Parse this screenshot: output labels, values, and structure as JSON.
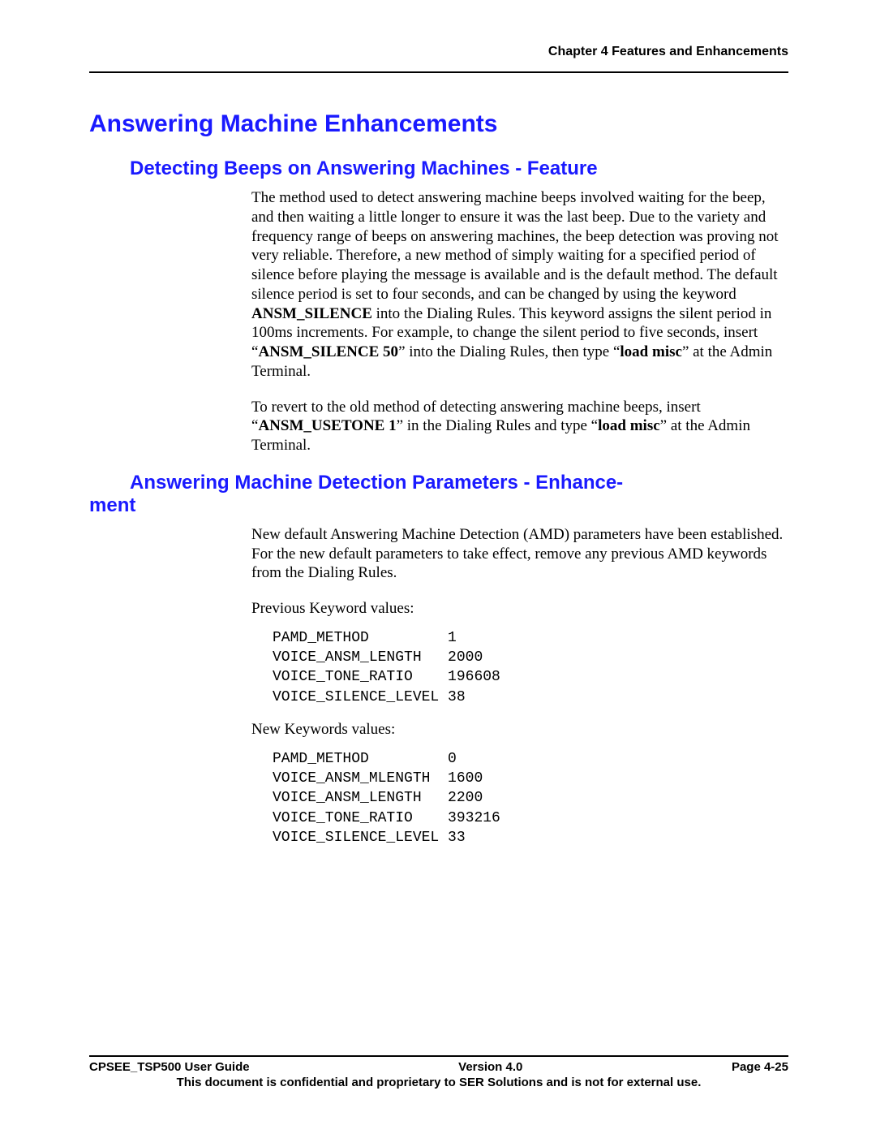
{
  "header": {
    "chapter": "Chapter 4 Features and Enhancements"
  },
  "h1": "Answering Machine Enhancements",
  "section1": {
    "heading": "Detecting Beeps on Answering Machines - Feature",
    "para1_a": "The method used to detect answering machine beeps involved waiting for the beep, and then waiting a little longer to ensure it was the last beep.  Due to the variety and frequency range of beeps on answering machines, the beep detection was proving not very reliable.   Therefore, a new method of simply waiting for a specified period of silence before playing the message is available and is the default method.  The default silence period is set to four seconds, and can be changed by using the keyword ",
    "kw1": "ANSM_SILENCE",
    "para1_b": " into the Dialing Rules.  This keyword assigns the silent period in 100ms increments.  For example, to change the silent period to five seconds, insert ",
    "para1_c_prefix": "“",
    "kw2": "ANSM_SILENCE 50",
    "para1_d": "” into the Dialing Rules, then type “",
    "kw3": "load misc",
    "para1_e": "” at the Admin Terminal.",
    "para2_a": "To revert to the old method of detecting answering machine beeps, insert “",
    "kw4": "ANSM_USETONE 1",
    "para2_b": "” in the Dialing Rules and type “",
    "kw5": "load misc",
    "para2_c": "” at the Admin Terminal."
  },
  "section2": {
    "heading_line1": "Answering Machine Detection Parameters - Enhance-",
    "heading_line2": "ment",
    "para1": "New default Answering Machine Detection (AMD) parameters have been established.  For the new default parameters to take effect, remove any previous AMD keywords from the Dialing Rules.",
    "prev_label": "Previous Keyword values:",
    "prev_block": "PAMD_METHOD         1\nVOICE_ANSM_LENGTH   2000\nVOICE_TONE_RATIO    196608\nVOICE_SILENCE_LEVEL 38",
    "new_label": "New Keywords values:",
    "new_block": "PAMD_METHOD         0\nVOICE_ANSM_MLENGTH  1600\nVOICE_ANSM_LENGTH   2200\nVOICE_TONE_RATIO    393216\nVOICE_SILENCE_LEVEL 33"
  },
  "footer": {
    "left": "CPSEE_TSP500 User Guide",
    "center": "Version 4.0",
    "right": "Page 4-25",
    "conf": "This document is confidential and proprietary to SER Solutions and is not for external use."
  }
}
